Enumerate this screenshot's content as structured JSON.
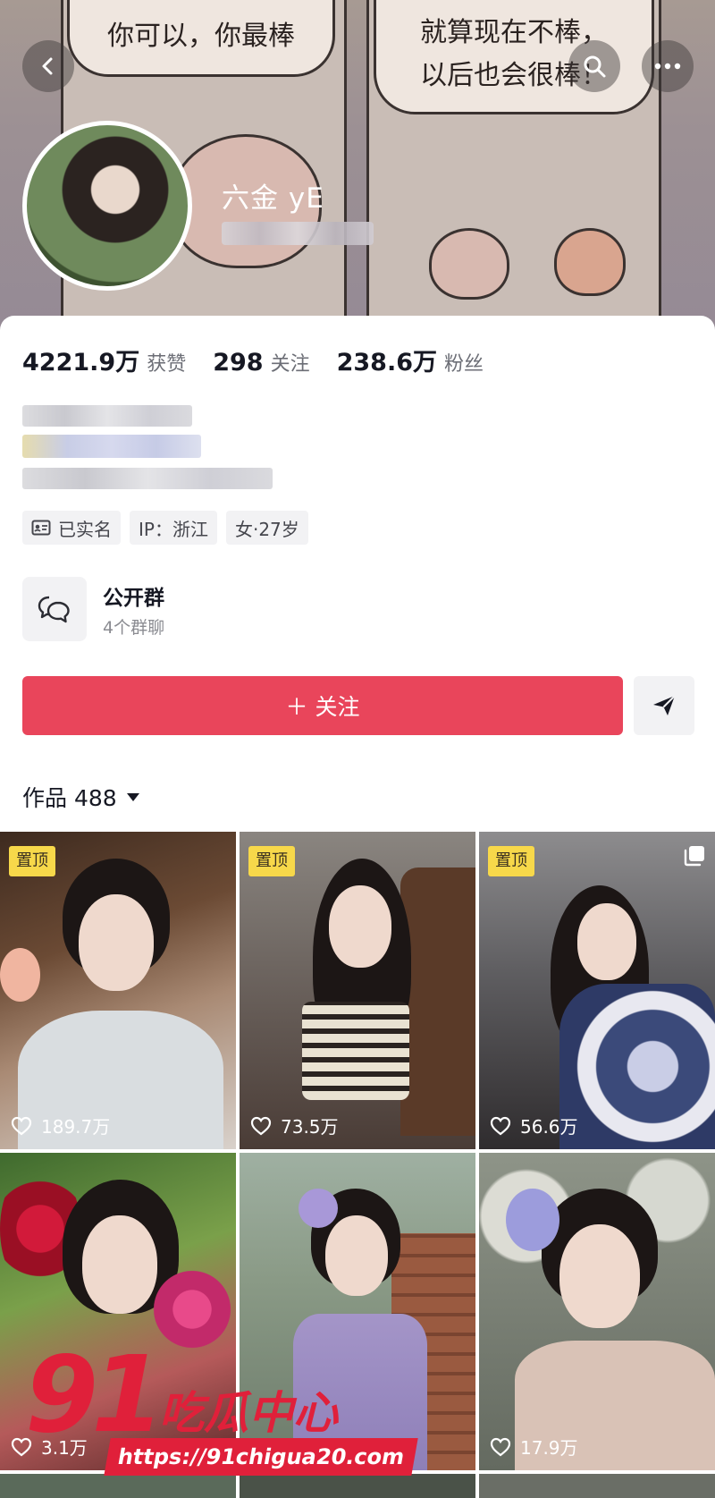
{
  "banner": {
    "bubble_left": "你可以，你最棒",
    "bubble_right_line1": "就算现在不棒，",
    "bubble_right_line2": "以后也会很棒！"
  },
  "profile": {
    "username": "六金 yE"
  },
  "stats": [
    {
      "value": "4221.9万",
      "label": "获赞"
    },
    {
      "value": "298",
      "label": "关注"
    },
    {
      "value": "238.6万",
      "label": "粉丝"
    }
  ],
  "tags": [
    {
      "icon": "id-card-icon",
      "label": "已实名"
    },
    {
      "icon": "",
      "label": "IP：浙江"
    },
    {
      "icon": "",
      "label": "女·27岁"
    }
  ],
  "group": {
    "title": "公开群",
    "subtitle": "4个群聊"
  },
  "actions": {
    "follow_label": "＋ 关注"
  },
  "works": {
    "label": "作品 488"
  },
  "posts": [
    {
      "pinned": "置顶",
      "likes": "189.7万",
      "multi": false
    },
    {
      "pinned": "置顶",
      "likes": "73.5万",
      "multi": false
    },
    {
      "pinned": "置顶",
      "likes": "56.6万",
      "multi": true
    },
    {
      "pinned": "",
      "likes": "3.1万",
      "multi": false
    },
    {
      "pinned": "",
      "likes": "",
      "multi": false
    },
    {
      "pinned": "",
      "likes": "17.9万",
      "multi": false
    }
  ],
  "watermark": {
    "logo": "91",
    "name": "吃瓜中心",
    "url": "https://91chigua20.com"
  },
  "colors": {
    "follow_button": "#e9455b",
    "pin_badge": "#f7d84a",
    "watermark": "#e0203a"
  }
}
